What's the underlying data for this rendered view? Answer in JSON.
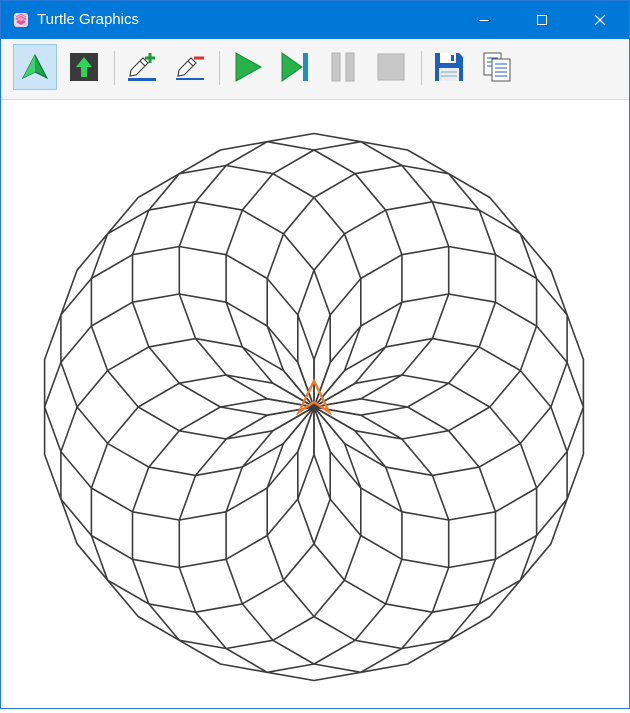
{
  "window": {
    "title": "Turtle Graphics",
    "accent_color": "#0078d7"
  },
  "titlebar_controls": [
    "minimize-icon",
    "maximize-icon",
    "close-icon"
  ],
  "toolbar": {
    "tools": [
      {
        "name": "show-turtle",
        "icon": "turtle-arrow-icon",
        "active": true
      },
      {
        "name": "pen-up",
        "icon": "up-arrow-icon",
        "active": false
      },
      {
        "name": "increase-pen-size",
        "icon": "pen-plus-icon",
        "active": false
      },
      {
        "name": "decrease-pen-size",
        "icon": "pen-minus-icon",
        "active": false
      },
      {
        "name": "run",
        "icon": "play-icon",
        "active": false
      },
      {
        "name": "step",
        "icon": "step-icon",
        "active": false
      },
      {
        "name": "pause",
        "icon": "pause-icon",
        "active": false
      },
      {
        "name": "stop",
        "icon": "stop-icon",
        "active": false
      },
      {
        "name": "save",
        "icon": "save-icon",
        "active": false
      },
      {
        "name": "copy",
        "icon": "copy-icon",
        "active": false
      }
    ]
  },
  "drawing": {
    "figure": "rotating-polygon-rosette",
    "rotations": 18,
    "sides": 18,
    "line_color": "#3c3c3c",
    "turtle_color": "#f07a30"
  }
}
